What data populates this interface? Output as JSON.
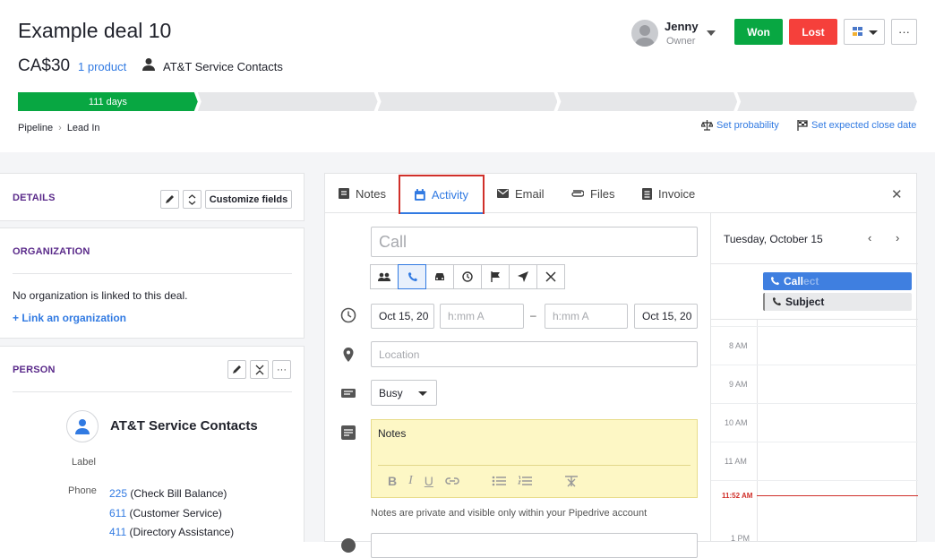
{
  "deal": {
    "title": "Example deal 10",
    "amount": "CA$30",
    "products": "1 product",
    "person": "AT&T Service Contacts"
  },
  "owner": {
    "name": "Jenny",
    "role": "Owner"
  },
  "actions": {
    "won": "Won",
    "lost": "Lost",
    "more": "···"
  },
  "pipeline": {
    "active_stage_label": "111 days",
    "stage_count": 5
  },
  "breadcrumb": {
    "pipeline": "Pipeline",
    "stage": "Lead In"
  },
  "links": {
    "set_probability": "Set probability",
    "set_close_date": "Set expected close date"
  },
  "details": {
    "title": "DETAILS",
    "customize": "Customize fields"
  },
  "organization": {
    "title": "ORGANIZATION",
    "empty_text": "No organization is linked to this deal.",
    "link_text": "+ Link an organization"
  },
  "person_card": {
    "title": "PERSON",
    "name": "AT&T Service Contacts",
    "label_key": "Label",
    "phone_key": "Phone",
    "phones": [
      {
        "number": "225",
        "desc": "(Check Bill Balance)"
      },
      {
        "number": "611",
        "desc": "(Customer Service)"
      },
      {
        "number": "411",
        "desc": "(Directory Assistance)"
      }
    ]
  },
  "tabs": [
    {
      "label": "Notes",
      "icon": "note-icon"
    },
    {
      "label": "Activity",
      "icon": "calendar-icon"
    },
    {
      "label": "Email",
      "icon": "mail-icon"
    },
    {
      "label": "Files",
      "icon": "paperclip-icon"
    },
    {
      "label": "Invoice",
      "icon": "invoice-icon"
    }
  ],
  "activity_form": {
    "subject_placeholder": "Call",
    "activity_types": [
      "meeting-icon",
      "call-icon",
      "car-icon",
      "clock-icon",
      "flag-icon",
      "send-icon",
      "lunch-icon"
    ],
    "selected_type_index": 1,
    "start_date": "Oct 15, 20",
    "start_time_placeholder": "h:mm A",
    "dash": "–",
    "end_time_placeholder": "h:mm A",
    "end_date": "Oct 15, 20",
    "location_placeholder": "Location",
    "busy_value": "Busy",
    "notes_label": "Notes",
    "notes_hint": "Notes are private and visible only within your Pipedrive account"
  },
  "calendar": {
    "date_label": "Tuesday, October 15",
    "events": [
      {
        "label": "Call",
        "ghost": "ect",
        "color": "#3f7fe0"
      },
      {
        "label": "Subject",
        "color": "#e8e9eb"
      }
    ],
    "hours": [
      "8 AM",
      "9 AM",
      "10 AM",
      "11 AM",
      "1 PM"
    ],
    "now_label": "11:52 AM",
    "now_color": "#d0302a"
  },
  "colors": {
    "accent": "#317ae2",
    "won": "#08a742",
    "lost": "#f5403b",
    "section_title": "#5a2a8a"
  }
}
